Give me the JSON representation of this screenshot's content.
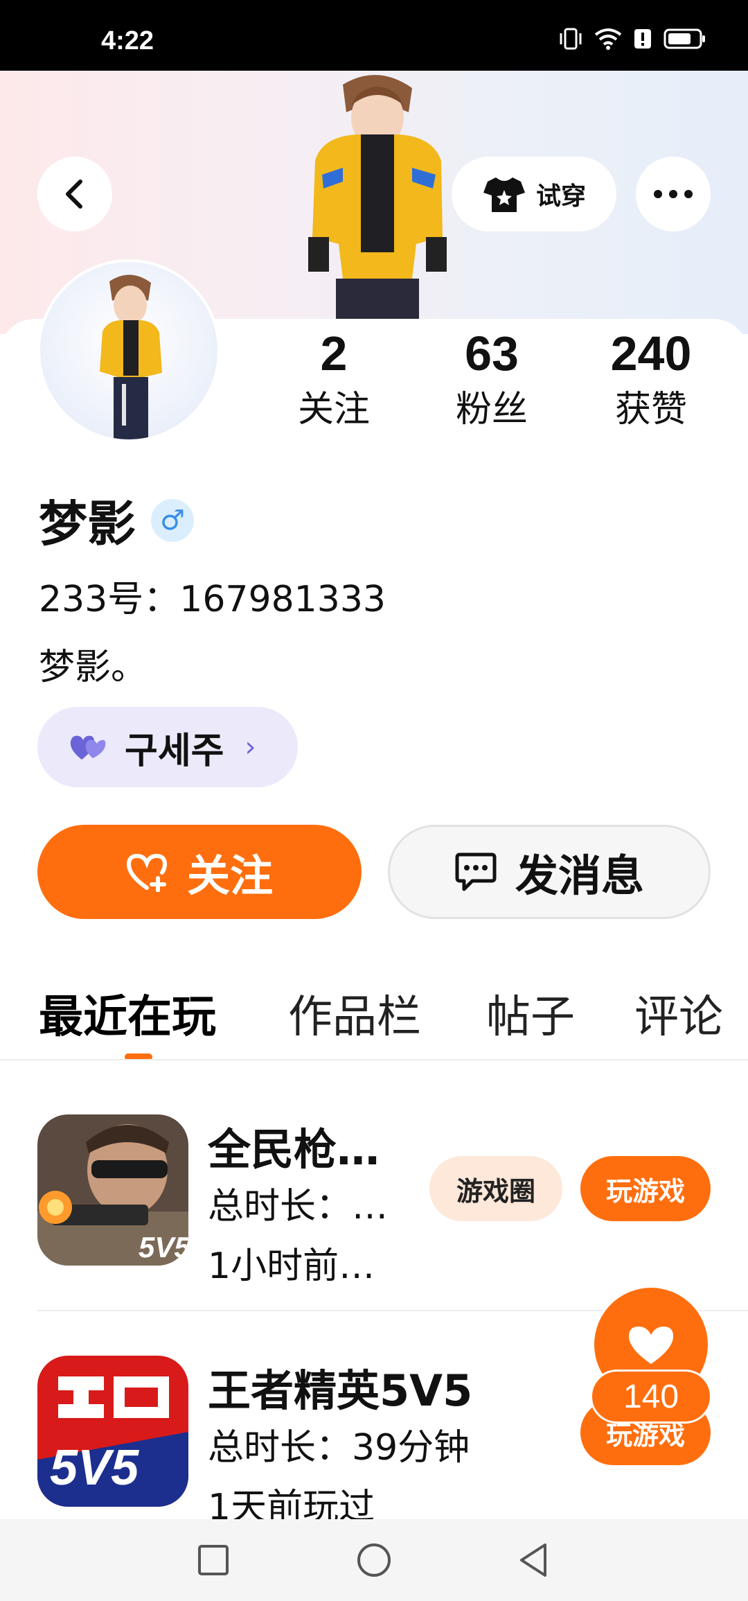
{
  "status_bar": {
    "time": "4:22"
  },
  "header": {
    "tryon_label": "试穿"
  },
  "profile": {
    "nickname": "梦影",
    "gender_symbol": "♂",
    "id_text": "233号：167981333",
    "signature": "梦影。",
    "guild_name": "구세주",
    "guild_chevron": "›"
  },
  "stats": [
    {
      "value": "2",
      "label": "关注"
    },
    {
      "value": "63",
      "label": "粉丝"
    },
    {
      "value": "240",
      "label": "获赞"
    }
  ],
  "actions": {
    "follow_label": "关注",
    "message_label": "发消息"
  },
  "tabs": [
    {
      "label": "最近在玩",
      "active": true
    },
    {
      "label": "作品栏",
      "active": false
    },
    {
      "label": "帖子",
      "active": false
    },
    {
      "label": "评论",
      "active": false
    }
  ],
  "games": [
    {
      "title": "全民枪…",
      "duration": "总时长：…",
      "last_played": "1小时前…",
      "circle_label": "游戏圈",
      "play_label": "玩游戏"
    },
    {
      "title": "王者精英5V5",
      "duration": "总时长：39分钟",
      "last_played": "1天前玩过",
      "play_label": "玩游戏"
    }
  ],
  "floating_like": {
    "count": "140"
  },
  "colors": {
    "accent": "#ff6e0e",
    "guild_bg": "#ece9fb",
    "circle_bg": "#fde8da"
  }
}
